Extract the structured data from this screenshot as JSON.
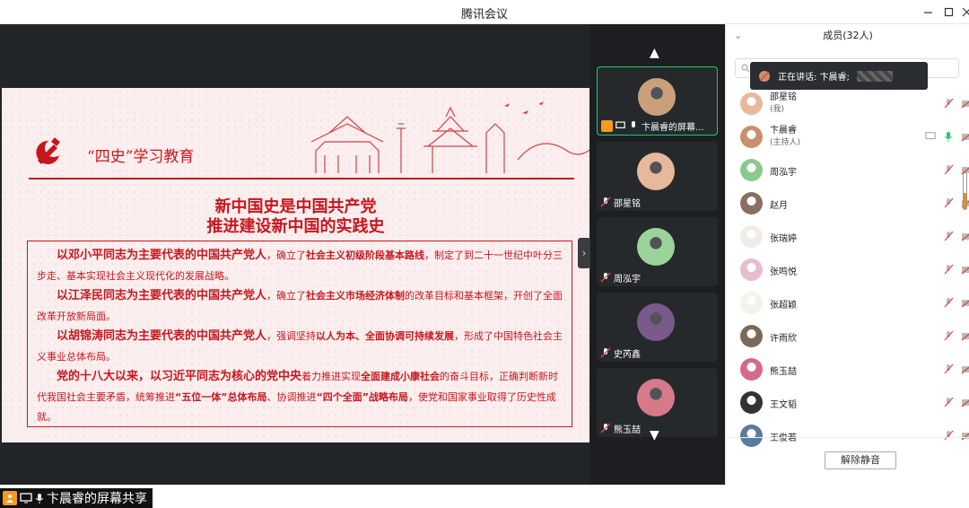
{
  "window": {
    "title": "腾讯会议"
  },
  "share": {
    "label": "卞晨睿的屏幕共享",
    "slide": {
      "header": "“四史”学习教育",
      "headline_1": "新中国史是中国共产党",
      "headline_2": "推进建设新中国的实践史",
      "paragraphs": [
        [
          {
            "t": "以邓小平同志为主要代表的中国共产党人",
            "s": "em"
          },
          {
            "t": "，确立了",
            "s": ""
          },
          {
            "t": "社会主义初级阶段基本路线",
            "s": "b"
          },
          {
            "t": "，制定了到二十一世纪中叶分三步走、基本实现社会主义现代化的发展战略。",
            "s": ""
          }
        ],
        [
          {
            "t": "以江泽民同志为主要代表的中国共产党人",
            "s": "em"
          },
          {
            "t": "，确立了",
            "s": ""
          },
          {
            "t": "社会主义市场经济体制",
            "s": "b"
          },
          {
            "t": "的改革目标和基本框架，开创了全面改革开放新局面。",
            "s": ""
          }
        ],
        [
          {
            "t": "以胡锦涛同志为主要代表的中国共产党人",
            "s": "em"
          },
          {
            "t": "，强调坚持",
            "s": ""
          },
          {
            "t": "以人为本、全面协调可持续发展",
            "s": "b"
          },
          {
            "t": "，形成了中国特色社会主义事业总体布局。",
            "s": ""
          }
        ],
        [
          {
            "t": "党的十八大以来，以习近平同志为核心的党中央",
            "s": "em"
          },
          {
            "t": "着力推进实现",
            "s": ""
          },
          {
            "t": "全面建成小康社会",
            "s": "b"
          },
          {
            "t": "的奋斗目标，正确判断新时代我国社会主要矛盾，统筹推进",
            "s": ""
          },
          {
            "t": "“五位一体”总体布局",
            "s": "b"
          },
          {
            "t": "、协调推进",
            "s": ""
          },
          {
            "t": "“四个全面”战略布局",
            "s": "b"
          },
          {
            "t": "，使党和国家事业取得了历史性成就。",
            "s": ""
          }
        ]
      ]
    }
  },
  "video_tiles": [
    {
      "name": "卞晨睿的屏幕...",
      "color": "#c9a07a",
      "active": true
    },
    {
      "name": "邵星铭",
      "color": "#e8b89a",
      "active": false
    },
    {
      "name": "周泓宇",
      "color": "#9ad49a",
      "active": false
    },
    {
      "name": "史芮鑫",
      "color": "#7a5a8a",
      "active": false
    },
    {
      "name": "熊玉喆",
      "color": "#d67a8a",
      "active": false
    }
  ],
  "panel": {
    "title": "成员(32人)",
    "speaking": "正在讲话: 卞晨睿;",
    "unmute_label": "解除静音",
    "members": [
      {
        "name": "邵星铭",
        "sub": "(我)",
        "color": "#e8b89a",
        "mic": "muted"
      },
      {
        "name": "卞晨睿",
        "sub": "(主持人)",
        "color": "#c9906a",
        "mic": "on"
      },
      {
        "name": "周泓宇",
        "sub": "",
        "color": "#8cc98c",
        "mic": "muted"
      },
      {
        "name": "赵月",
        "sub": "",
        "color": "#8a7060",
        "mic": "muted"
      },
      {
        "name": "张瑞婷",
        "sub": "",
        "color": "#f2ece6",
        "mic": "muted"
      },
      {
        "name": "张鸣悦",
        "sub": "",
        "color": "#e8bcd0",
        "mic": "muted"
      },
      {
        "name": "张超颖",
        "sub": "",
        "color": "#f4f2ea",
        "mic": "muted"
      },
      {
        "name": "许雨欣",
        "sub": "",
        "color": "#7a6a5a",
        "mic": "muted"
      },
      {
        "name": "熊玉喆",
        "sub": "",
        "color": "#d66a8a",
        "mic": "muted"
      },
      {
        "name": "王文韬",
        "sub": "",
        "color": "#333333",
        "mic": "muted"
      },
      {
        "name": "王俊若",
        "sub": "",
        "color": "#5a7aa0",
        "mic": "muted"
      }
    ]
  },
  "colors": {
    "party_red": "#c8161d",
    "accent_orange": "#f39b1e",
    "active_green": "#1ecb6e"
  }
}
